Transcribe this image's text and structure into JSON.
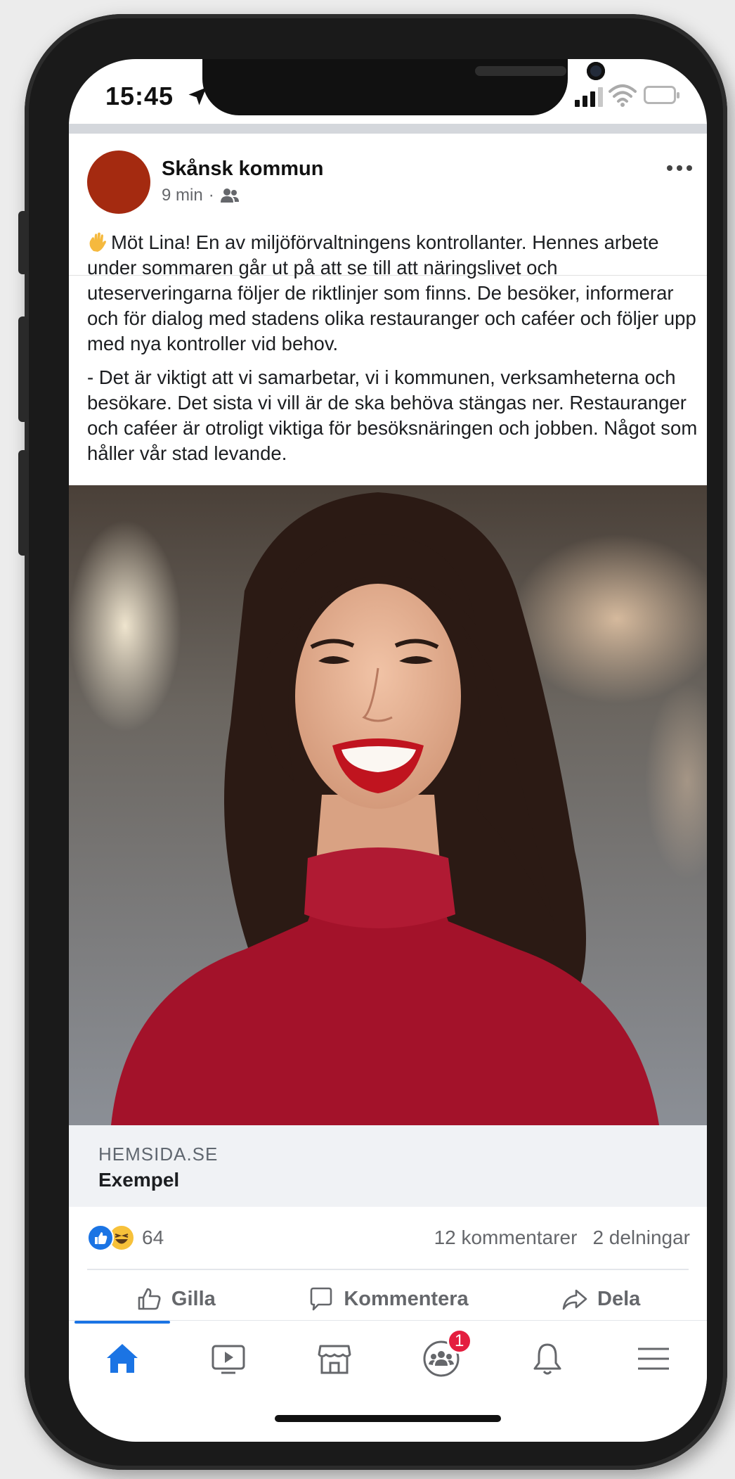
{
  "status_bar": {
    "time": "15:45"
  },
  "post": {
    "author": "Skånsk kommun",
    "time_ago": "9 min",
    "separator": "·",
    "paragraph_1": "Möt Lina! En av miljöförvaltningens kontrollanter. Hennes arbete under sommaren går ut på att se till att näringslivet och uteserveringarna följer de riktlinjer som finns. De besöker, informerar och för dialog med stadens olika restauranger och caféer och följer upp med nya kontroller vid behov.",
    "paragraph_2": "- Det är viktigt att vi samarbetar, vi i kommunen, verksamhe­terna och besökare. Det sista vi vill är de ska behöva stängas ner. Restauranger och caféer är otroligt viktiga för besöksnä­ringen och jobben. Något som håller vår stad levande."
  },
  "link_preview": {
    "domain": "HEMSIDA.SE",
    "title": "Exempel"
  },
  "engagement": {
    "reaction_count": "64",
    "comments": "12 kommentarer",
    "shares": "2 delningar"
  },
  "actions": {
    "like": "Gilla",
    "comment": "Kommentera",
    "share": "Dela"
  },
  "tab_bar": {
    "groups_badge": "1"
  },
  "colors": {
    "accent": "#1b74e4",
    "badge": "#e41e3f",
    "avatar": "#a42a10",
    "shirt": "#a3122a"
  }
}
